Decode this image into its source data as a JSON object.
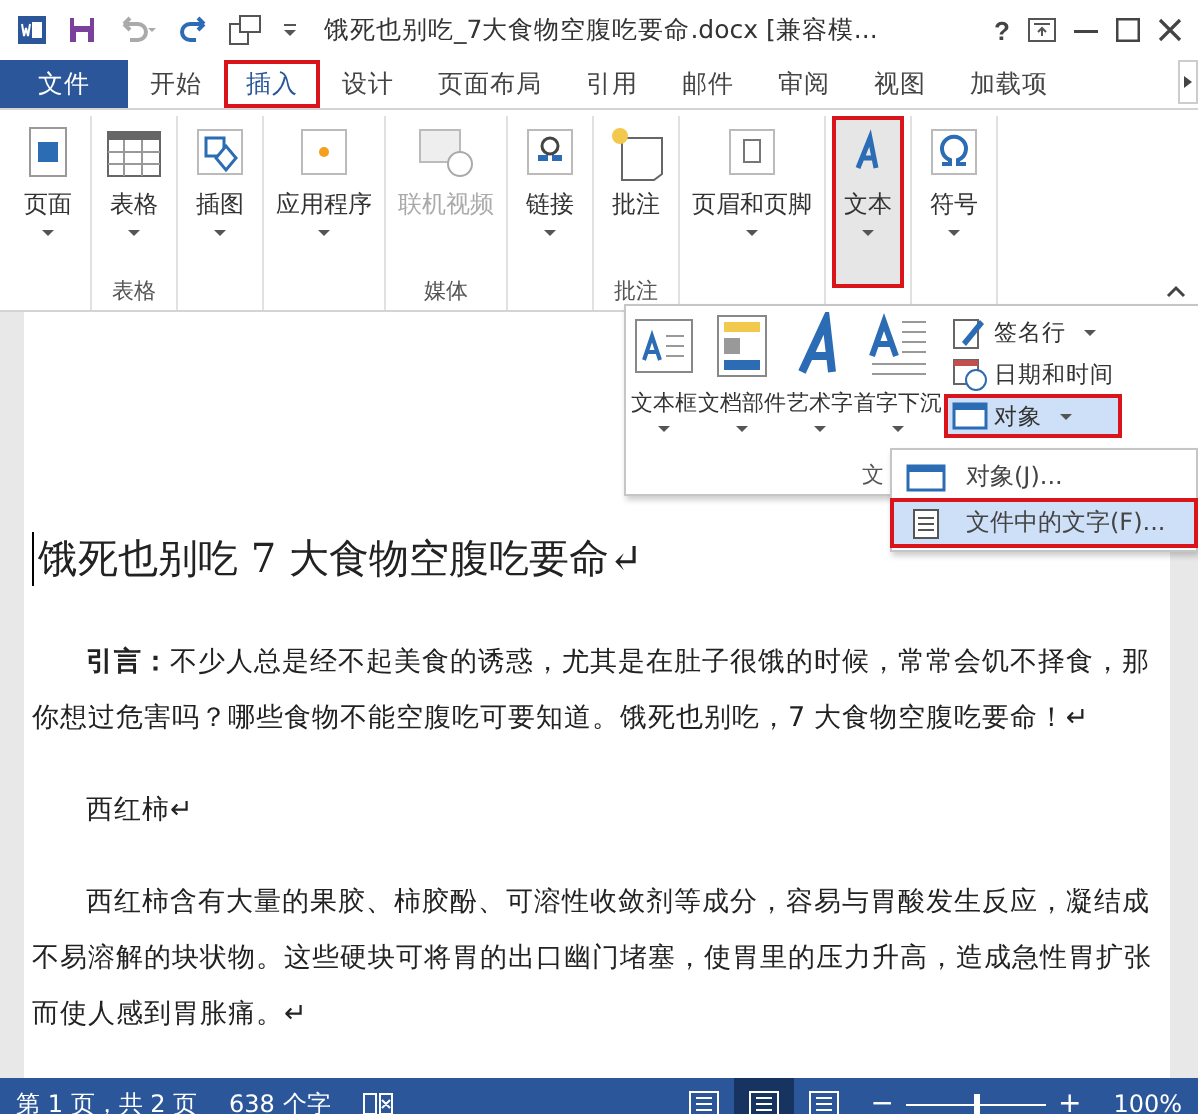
{
  "window": {
    "title": "饿死也别吃_7大食物空腹吃要命.docx [兼容模...",
    "controls": [
      "?"
    ]
  },
  "tabs": [
    {
      "label": "文件",
      "kind": "file",
      "selected": false,
      "marked": false
    },
    {
      "label": "开始",
      "kind": "tab",
      "selected": false,
      "marked": false
    },
    {
      "label": "插入",
      "kind": "tab",
      "selected": true,
      "marked": true
    },
    {
      "label": "设计",
      "kind": "tab",
      "selected": false,
      "marked": false
    },
    {
      "label": "页面布局",
      "kind": "tab",
      "selected": false,
      "marked": false
    },
    {
      "label": "引用",
      "kind": "tab",
      "selected": false,
      "marked": false
    },
    {
      "label": "邮件",
      "kind": "tab",
      "selected": false,
      "marked": false
    },
    {
      "label": "审阅",
      "kind": "tab",
      "selected": false,
      "marked": false
    },
    {
      "label": "视图",
      "kind": "tab",
      "selected": false,
      "marked": false
    },
    {
      "label": "加载项",
      "kind": "tab",
      "selected": false,
      "marked": false
    }
  ],
  "ribbon": {
    "groups": [
      {
        "buttons": [
          {
            "label": "页面",
            "arrow": true,
            "disabled": false,
            "pressed": false,
            "marked": false
          }
        ]
      },
      {
        "label": "表格",
        "buttons": [
          {
            "label": "表格",
            "arrow": true,
            "disabled": false,
            "pressed": false,
            "marked": false
          }
        ]
      },
      {
        "buttons": [
          {
            "label": "插图",
            "arrow": true,
            "disabled": false,
            "pressed": false,
            "marked": false
          }
        ]
      },
      {
        "buttons": [
          {
            "label": "应用程序",
            "arrow": true,
            "disabled": false,
            "pressed": false,
            "marked": false
          }
        ]
      },
      {
        "label": "媒体",
        "buttons": [
          {
            "label": "联机视频",
            "arrow": false,
            "disabled": true,
            "pressed": false,
            "marked": false
          }
        ]
      },
      {
        "buttons": [
          {
            "label": "链接",
            "arrow": true,
            "disabled": false,
            "pressed": false,
            "marked": false
          }
        ]
      },
      {
        "label": "批注",
        "buttons": [
          {
            "label": "批注",
            "arrow": false,
            "disabled": false,
            "pressed": false,
            "marked": false
          }
        ]
      },
      {
        "buttons": [
          {
            "label": "页眉和页脚",
            "arrow": true,
            "disabled": false,
            "pressed": false,
            "marked": false
          }
        ]
      },
      {
        "buttons": [
          {
            "label": "文本",
            "arrow": true,
            "disabled": false,
            "pressed": true,
            "marked": true
          }
        ]
      },
      {
        "buttons": [
          {
            "label": "符号",
            "arrow": true,
            "disabled": false,
            "pressed": false,
            "marked": false
          }
        ]
      }
    ]
  },
  "text_panel": {
    "large": [
      {
        "label": "文本框",
        "arrow": true
      },
      {
        "label": "文档部件",
        "arrow": true
      },
      {
        "label": "艺术字",
        "arrow": true
      },
      {
        "label": "首字下沉",
        "arrow": true
      }
    ],
    "small": [
      {
        "label": "签名行",
        "arrow": true,
        "selected": false,
        "marked": false
      },
      {
        "label": "日期和时间",
        "arrow": false,
        "selected": false,
        "marked": false
      },
      {
        "label": "对象",
        "arrow": true,
        "selected": true,
        "marked": true
      }
    ],
    "group_label": "文"
  },
  "submenu": [
    {
      "label": "对象(J)...",
      "selected": false,
      "marked": false
    },
    {
      "label": "文件中的文字(F)...",
      "selected": true,
      "marked": true
    }
  ],
  "document": {
    "title": "饿死也别吃 7 大食物空腹吃要命↵",
    "paragraphs": [
      "**引言：**不少人总是经不起美食的诱惑，尤其是在肚子很饿的时候，常常会饥不择食，那你想过危害吗？哪些食物不能空腹吃可要知道。饿死也别吃，7 大食物空腹吃要命！↵",
      "西红柿↵",
      "西红柿含有大量的果胶、柿胶酚、可溶性收敛剂等成分，容易与胃酸发生反应，凝结成不易溶解的块状物。这些硬块可将胃的出口幽门堵塞，使胃里的压力升高，造成急性胃扩张而使人感到胃胀痛。↵"
    ]
  },
  "status_bar": {
    "page": "第 1 页，共 2 页",
    "words": "638 个字",
    "views": [
      {
        "selected": false
      },
      {
        "selected": true
      },
      {
        "selected": false
      }
    ],
    "zoom_out": "−",
    "zoom_slider": {
      "level": 0.5
    },
    "zoom_in": "+",
    "zoom": "100%"
  }
}
